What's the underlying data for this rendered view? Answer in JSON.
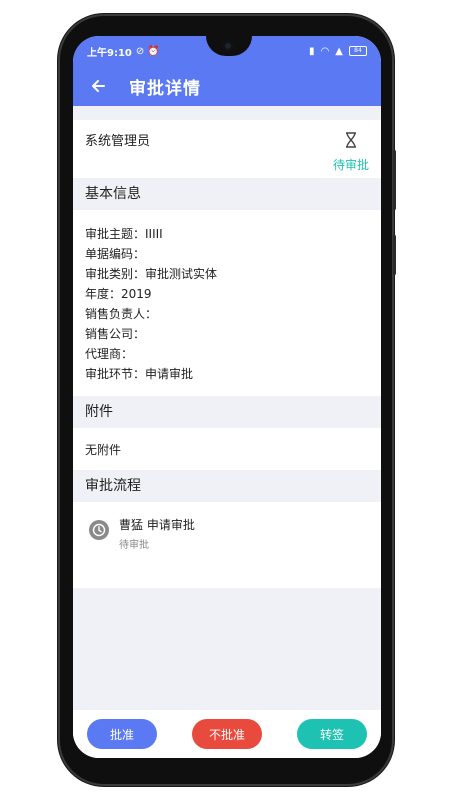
{
  "status_bar": {
    "time": "上午9:10",
    "battery": "84"
  },
  "header": {
    "title": "审批详情"
  },
  "approver": {
    "name": "系统管理员",
    "status": "待审批",
    "status_color": "#1ec2b3"
  },
  "basic_info": {
    "section_title": "基本信息",
    "rows": [
      {
        "label": "审批主题：",
        "value": "IIIII"
      },
      {
        "label": "单据编码：",
        "value": ""
      },
      {
        "label": "审批类别：",
        "value": "审批测试实体"
      },
      {
        "label": "年度：",
        "value": "2019"
      },
      {
        "label": "销售负责人：",
        "value": ""
      },
      {
        "label": "销售公司：",
        "value": ""
      },
      {
        "label": "代理商：",
        "value": ""
      },
      {
        "label": "审批环节：",
        "value": "申请审批"
      }
    ]
  },
  "attachments": {
    "section_title": "附件",
    "empty_text": "无附件"
  },
  "flow": {
    "section_title": "审批流程",
    "items": [
      {
        "title": "曹猛 申请审批",
        "status": "待审批"
      }
    ]
  },
  "actions": {
    "approve": "批准",
    "reject": "不批准",
    "transfer": "转签"
  },
  "colors": {
    "primary": "#5b79f3",
    "danger": "#e84a3d",
    "accent": "#1ec2b3"
  }
}
